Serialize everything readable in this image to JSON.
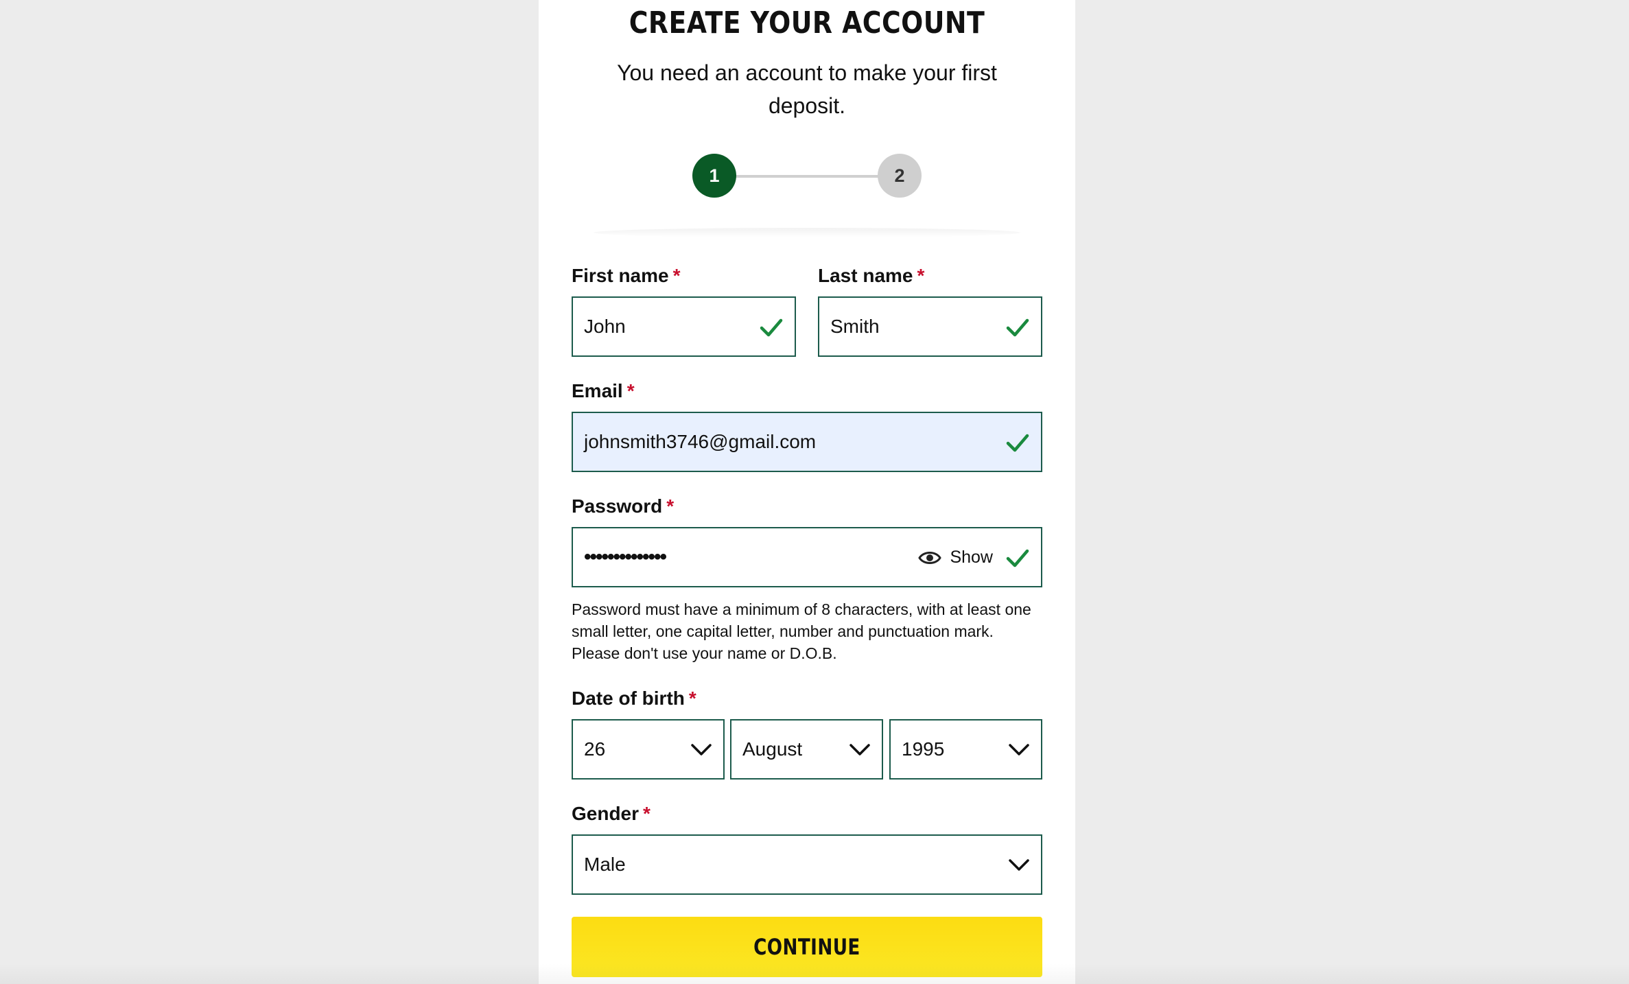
{
  "header": {
    "title": "CREATE YOUR ACCOUNT",
    "subtitle": "You need an account to make your first deposit."
  },
  "progress": {
    "steps": [
      "1",
      "2"
    ],
    "current_step": 1
  },
  "form": {
    "required_mark": "*",
    "first_name": {
      "label": "First name",
      "value": "John"
    },
    "last_name": {
      "label": "Last name",
      "value": "Smith"
    },
    "email": {
      "label": "Email",
      "value": "johnsmith3746@gmail.com"
    },
    "password": {
      "label": "Password",
      "masked_value": "••••••••••••••",
      "show_label": "Show",
      "helper": "Password must have a minimum of 8 characters, with at least one small letter, one capital letter, number and punctuation mark. Please don't use your name or D.O.B."
    },
    "dob": {
      "label": "Date of birth",
      "day": "26",
      "month": "August",
      "year": "1995"
    },
    "gender": {
      "label": "Gender",
      "value": "Male"
    },
    "continue_label": "CONTINUE"
  },
  "colors": {
    "brand_green": "#0a5a26",
    "valid_check": "#1a8a3e",
    "required_star": "#c8102e",
    "cta_yellow": "#fce31b",
    "field_border": "#1c5b4c"
  }
}
